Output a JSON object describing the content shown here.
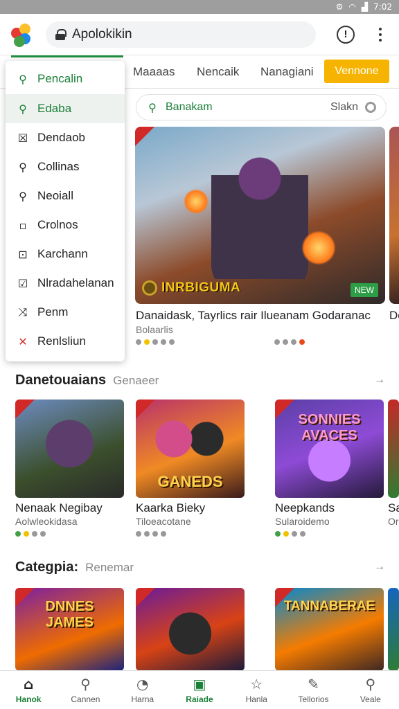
{
  "status": {
    "time": "7:02"
  },
  "browser": {
    "url": "Apolokikin"
  },
  "tabs": [
    {
      "label": "Maaaas"
    },
    {
      "label": "Nencaik"
    },
    {
      "label": "Nanagiani"
    },
    {
      "label": "Vennone"
    }
  ],
  "dropdown": {
    "items": [
      {
        "label": "Pencalin",
        "icon": "search-icon"
      },
      {
        "label": "Edaba",
        "icon": "search-icon"
      },
      {
        "label": "Dendaob",
        "icon": "checkbox-icon"
      },
      {
        "label": "Collinas",
        "icon": "search-icon"
      },
      {
        "label": "Neoiall",
        "icon": "search-icon"
      },
      {
        "label": "Crolnos",
        "icon": "square-icon"
      },
      {
        "label": "Karchann",
        "icon": "exit-icon"
      },
      {
        "label": "Nlradahelanan",
        "icon": "checkbox-icon"
      },
      {
        "label": "Penm",
        "icon": "shuffle-icon"
      },
      {
        "label": "Renlsliun",
        "icon": "cross-icon"
      }
    ]
  },
  "search": {
    "placeholder": "Banakam",
    "right_label": "Slakn"
  },
  "featured": {
    "title": "INRBIGUMA",
    "caption": "Danaidask, Tayrlics rair Ilueanam Godaranac",
    "caption_next": "De",
    "subtitle": "Bolaarlis",
    "badge": "NEW"
  },
  "section1": {
    "title": "Danetouaians",
    "subtitle": "Genaeer",
    "arrow": "→"
  },
  "section2": {
    "title": "Categpia:",
    "subtitle": "Renemar",
    "arrow": "→"
  },
  "games_row1": [
    {
      "title": "Nenaak Negibay",
      "sub": "Aolwleokidasa",
      "label": ""
    },
    {
      "title": "Kaarka Bieky",
      "sub": "Tiloeacotane",
      "label": "GANEDS"
    },
    {
      "title": "Neepkands",
      "sub": "Sularoidemo",
      "label": "SONNIES AVACES"
    },
    {
      "title": "Sa",
      "sub": "Or",
      "label": ""
    }
  ],
  "games_row2": [
    {
      "label": "DNNES JAMES"
    },
    {
      "label": ""
    },
    {
      "label": "TANNABERAE"
    }
  ],
  "navbar": [
    {
      "label": "Hanok",
      "icon": "home-icon"
    },
    {
      "label": "Cannen",
      "icon": "search-icon"
    },
    {
      "label": "Harna",
      "icon": "compass-icon"
    },
    {
      "label": "Raiade",
      "icon": "games-icon"
    },
    {
      "label": "Hanla",
      "icon": "star-icon"
    },
    {
      "label": "Tellorios",
      "icon": "edit-icon"
    },
    {
      "label": "Veale",
      "icon": "search-icon"
    }
  ],
  "colors": {
    "accent": "#1a7f37",
    "cta": "#f6b400"
  }
}
